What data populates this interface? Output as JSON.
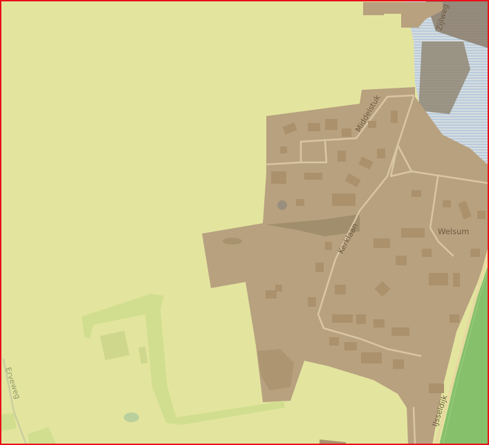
{
  "map": {
    "labels": {
      "zijlweg": "Zijlweg",
      "middelstuk": "Middelstuk",
      "kerklaan": "Kerklaan",
      "welsum": "Welsum",
      "erveweg": "Erveweg",
      "ijsseldijk": "IJsseldijk"
    },
    "colors": {
      "agricultural": "#e3e59f",
      "built_up": "#b8a17f",
      "building": "#ab916c",
      "park": "#d2de8f",
      "road": "#d9c6a5",
      "water": "#9cb9d6",
      "meadow": "#86c06a",
      "border": "#e8101a"
    }
  }
}
